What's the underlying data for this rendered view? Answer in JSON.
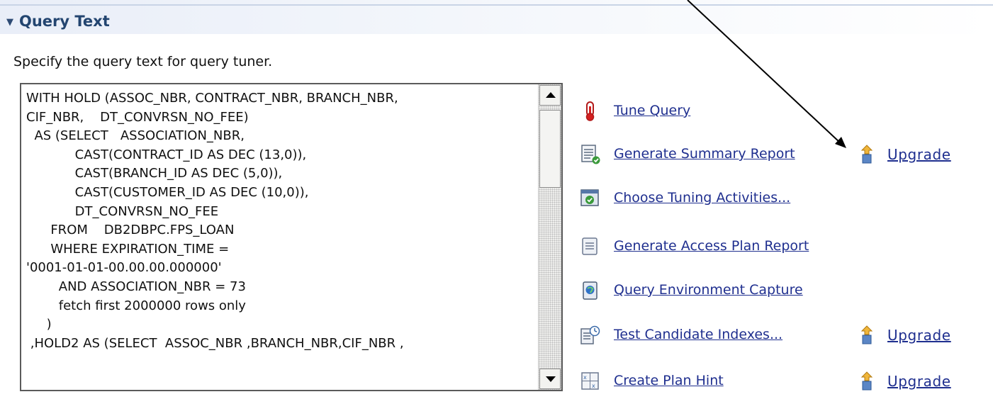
{
  "section": {
    "title": "Query Text",
    "description": "Specify the query text for query tuner."
  },
  "query": {
    "text": "WITH HOLD (ASSOC_NBR, CONTRACT_NBR, BRANCH_NBR,\nCIF_NBR,    DT_CONVRSN_NO_FEE)\n  AS (SELECT   ASSOCIATION_NBR,\n            CAST(CONTRACT_ID AS DEC (13,0)),\n            CAST(BRANCH_ID AS DEC (5,0)),\n            CAST(CUSTOMER_ID AS DEC (10,0)),\n            DT_CONVRSN_NO_FEE\n      FROM    DB2DBPC.FPS_LOAN\n      WHERE EXPIRATION_TIME =\n'0001-01-01-00.00.00.000000'\n        AND ASSOCIATION_NBR = 73\n        fetch first 2000000 rows only\n     )\n ,HOLD2 AS (SELECT  ASSOC_NBR ,BRANCH_NBR,CIF_NBR ,"
  },
  "actions": [
    {
      "label": "Tune Query",
      "icon": "thermometer-icon"
    },
    {
      "label": "Generate Summary Report",
      "icon": "report-icon",
      "upgrade": "Upgrade"
    },
    {
      "label": "Choose Tuning Activities...",
      "icon": "tuning-activities-icon"
    },
    {
      "label": "Generate Access Plan Report",
      "icon": "access-plan-report-icon"
    },
    {
      "label": "Query Environment Capture",
      "icon": "environment-capture-icon"
    },
    {
      "label": "Test Candidate Indexes...",
      "icon": "test-indexes-icon",
      "upgrade": "Upgrade"
    },
    {
      "label": "Create Plan Hint",
      "icon": "plan-hint-icon",
      "upgrade": "Upgrade"
    }
  ],
  "colors": {
    "link": "#1f2f8f",
    "header_text": "#234570",
    "upgrade_icon": "#e8a52a"
  }
}
